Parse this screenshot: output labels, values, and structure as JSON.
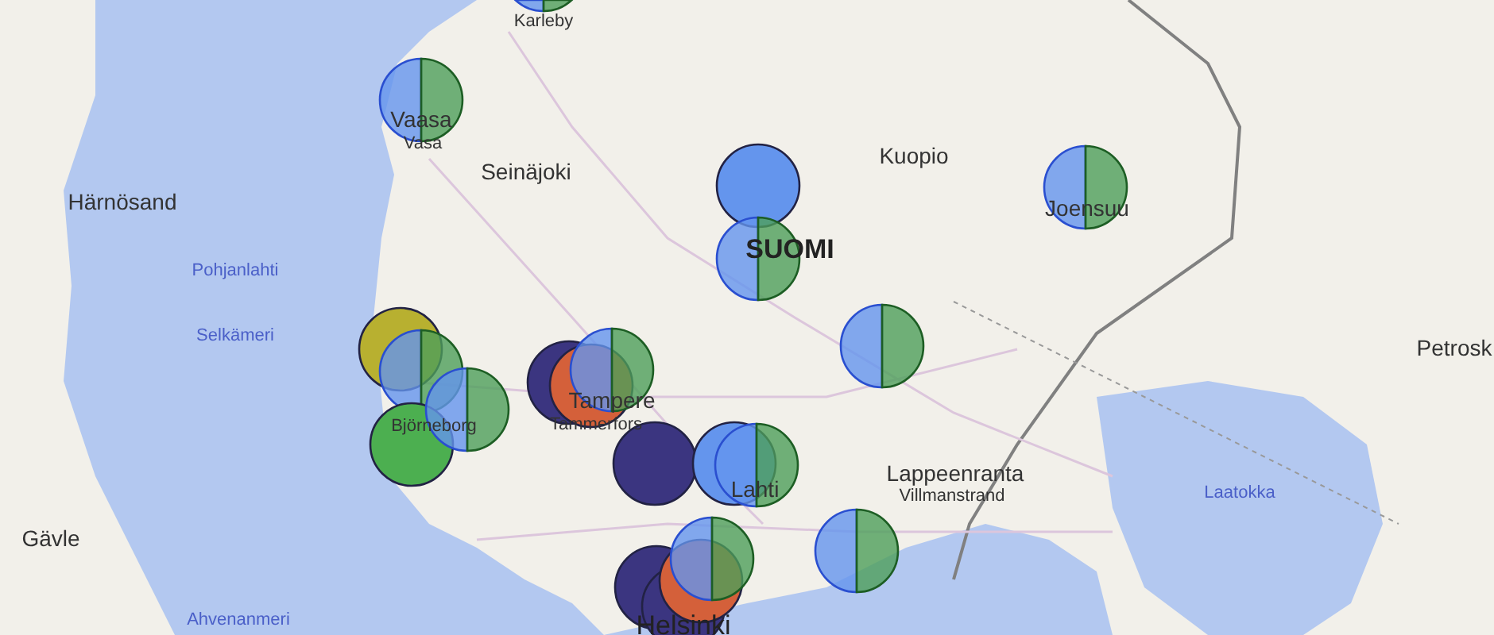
{
  "map": {
    "labels": [
      {
        "kind": "town",
        "text": "Karleby"
      },
      {
        "kind": "city",
        "text": "Vaasa"
      },
      {
        "kind": "town",
        "text": "Vasa"
      },
      {
        "kind": "city",
        "text": "Seinäjoki"
      },
      {
        "kind": "city",
        "text": "Härnösand"
      },
      {
        "kind": "city",
        "text": "Kuopio"
      },
      {
        "kind": "country",
        "text": "SUOMI"
      },
      {
        "kind": "city",
        "text": "Joensuu"
      },
      {
        "kind": "sea",
        "text": "Pohjanlahti"
      },
      {
        "kind": "sea",
        "text": "Selkämeri"
      },
      {
        "kind": "town",
        "text": "Björneborg"
      },
      {
        "kind": "city",
        "text": "Tampere"
      },
      {
        "kind": "town",
        "text": "Tammerfors"
      },
      {
        "kind": "city",
        "text": "Lahti"
      },
      {
        "kind": "city",
        "text": "Lappeenranta"
      },
      {
        "kind": "town",
        "text": "Villmanstrand"
      },
      {
        "kind": "city",
        "text": "Gävle"
      },
      {
        "kind": "sea",
        "text": "Laatokka"
      },
      {
        "kind": "city",
        "text": "Petrosk"
      },
      {
        "kind": "sea",
        "text": "Ahvenanmeri"
      },
      {
        "kind": "capital",
        "text": "Helsinki"
      }
    ],
    "bubbles": [
      {
        "kind": "split"
      },
      {
        "kind": "split"
      },
      {
        "kind": "solid",
        "color": "#6495ed"
      },
      {
        "kind": "split"
      },
      {
        "kind": "split"
      },
      {
        "kind": "split"
      },
      {
        "kind": "split"
      },
      {
        "kind": "solid",
        "color": "#b8b030"
      },
      {
        "kind": "split"
      },
      {
        "kind": "solid",
        "color": "#4caf50"
      },
      {
        "kind": "split"
      },
      {
        "kind": "solid",
        "color": "#3b3580"
      },
      {
        "kind": "solid",
        "color": "#d4603a"
      },
      {
        "kind": "split"
      },
      {
        "kind": "solid",
        "color": "#3b3580"
      },
      {
        "kind": "solid",
        "color": "#6495ed"
      },
      {
        "kind": "split"
      },
      {
        "kind": "solid",
        "color": "#3b3580"
      },
      {
        "kind": "solid",
        "color": "#3b3580"
      },
      {
        "kind": "solid",
        "color": "#d4603a"
      },
      {
        "kind": "split"
      }
    ]
  }
}
